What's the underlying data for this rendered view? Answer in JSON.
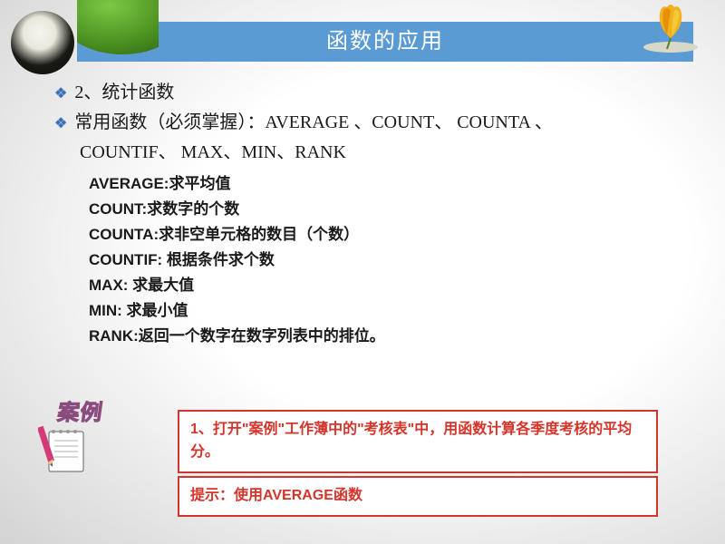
{
  "title": "函数的应用",
  "bullets": {
    "b1": "2、统计函数",
    "b2_prefix": "常用函数（必须掌握）：",
    "b2_list": "AVERAGE 、COUNT、 COUNTA 、",
    "b2_cont": "COUNTIF、 MAX、MIN、RANK"
  },
  "defs": {
    "average": "AVERAGE:求平均值",
    "count": "COUNT:求数字的个数",
    "counta": "COUNTA:求非空单元格的数目（个数）",
    "countif": "COUNTIF: 根据条件求个数",
    "max": "MAX: 求最大值",
    "min": "MIN: 求最小值",
    "rank": "RANK:返回一个数字在数字列表中的排位。"
  },
  "case_label": "案例",
  "box1": "1、打开\"案例\"工作薄中的\"考核表\"中，用函数计算各季度考核的平均分。",
  "box2": "提示：使用AVERAGE函数"
}
